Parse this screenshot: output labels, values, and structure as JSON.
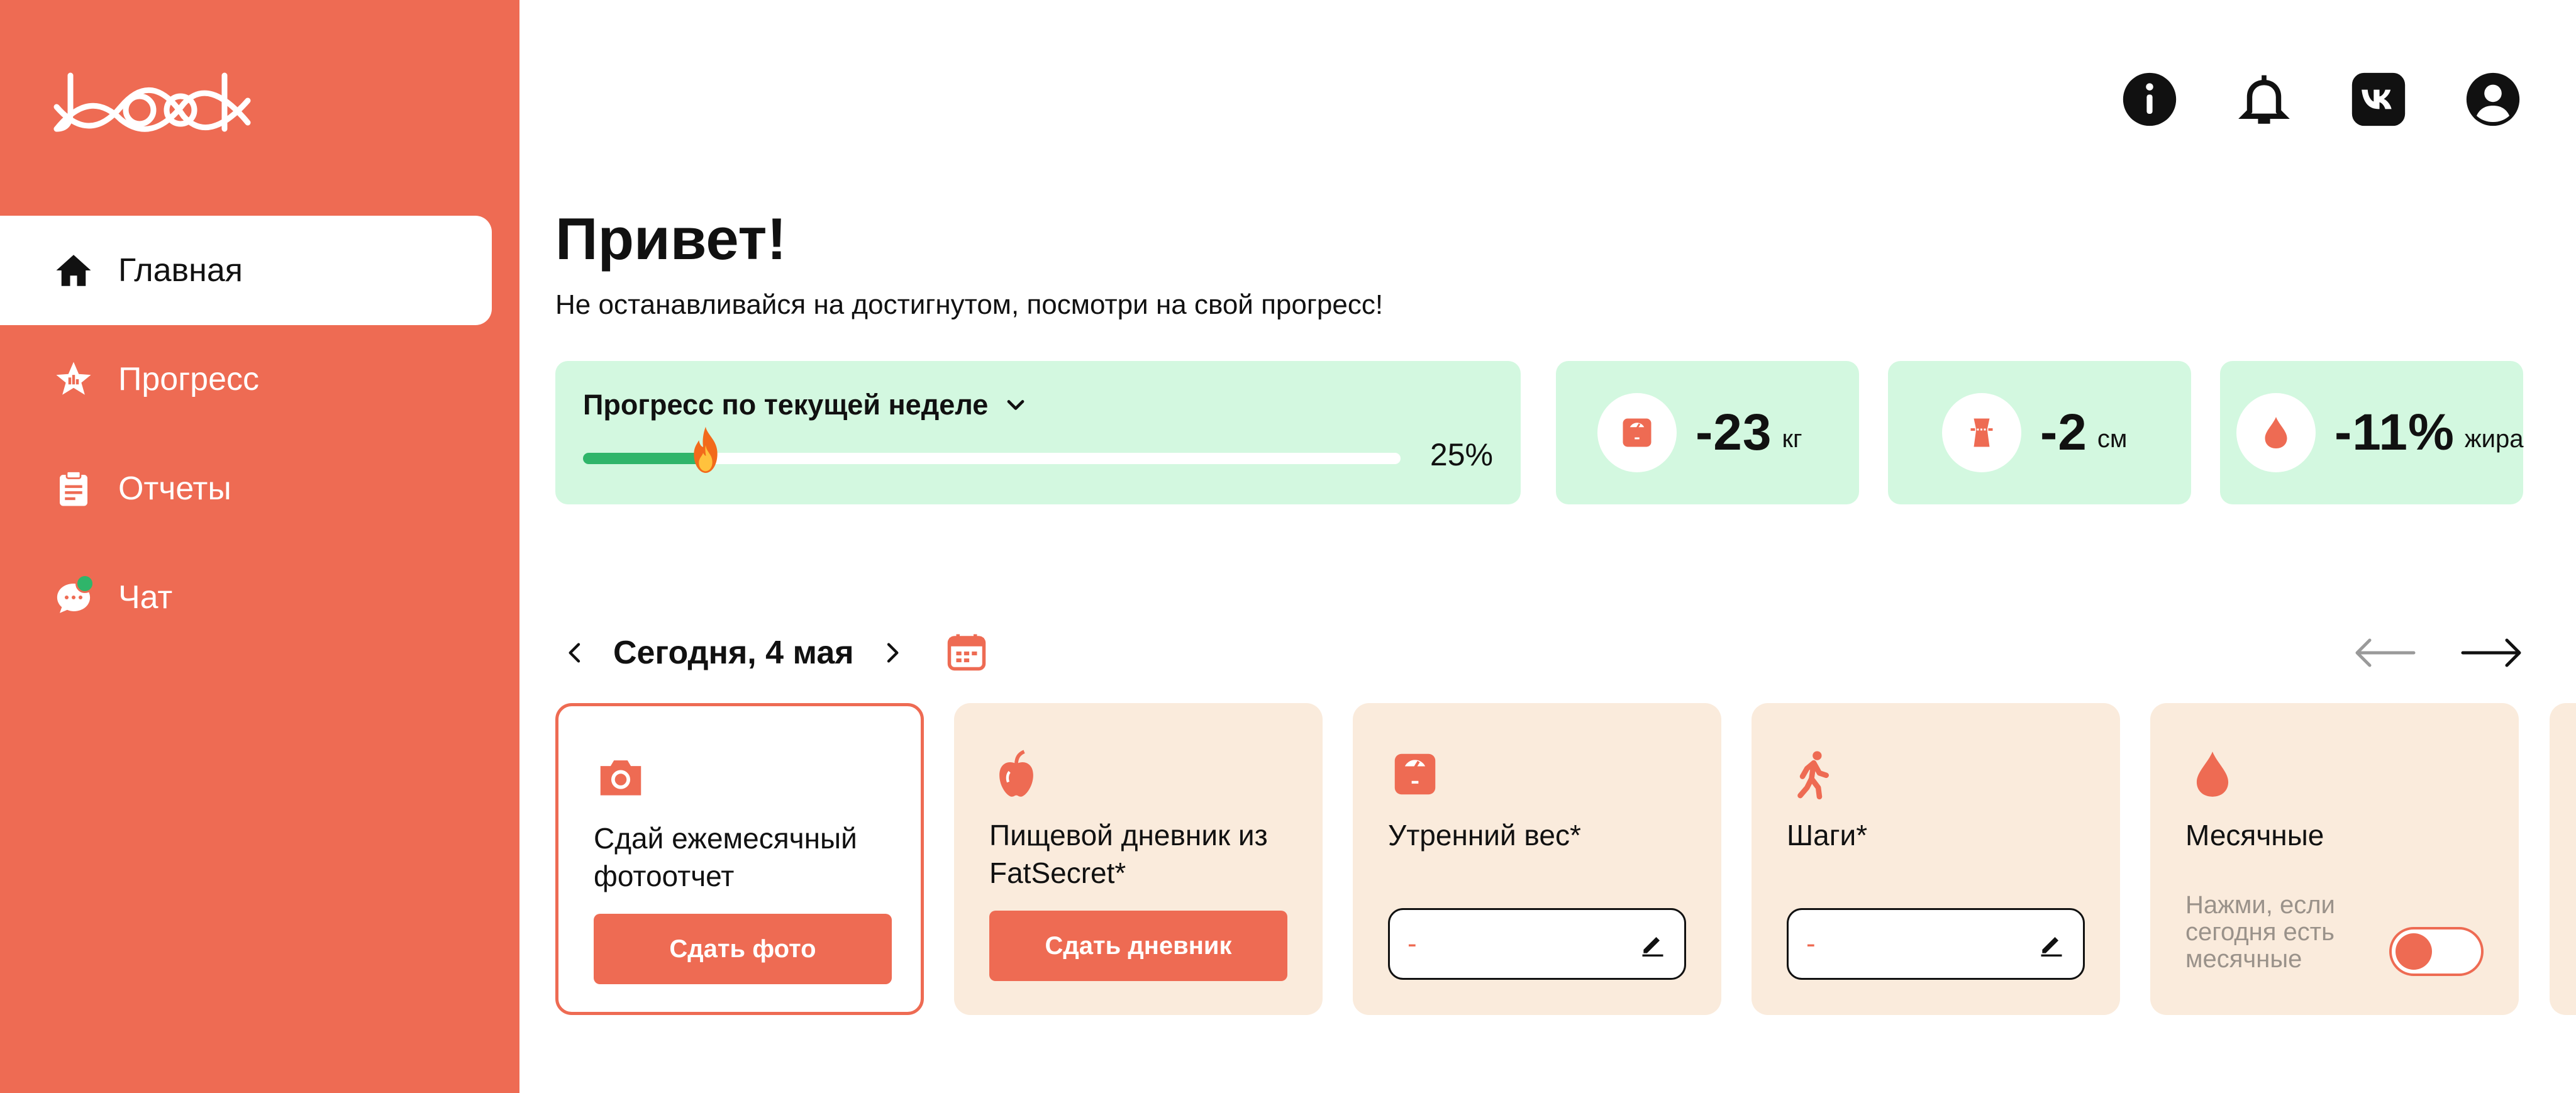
{
  "sidebar": {
    "logo_text": "Jbeak",
    "items": [
      {
        "label": "Главная",
        "icon": "home-icon",
        "active": true
      },
      {
        "label": "Прогресс",
        "icon": "star-icon",
        "active": false
      },
      {
        "label": "Отчеты",
        "icon": "clipboard-icon",
        "active": false
      },
      {
        "label": "Чат",
        "icon": "chat-icon",
        "active": false,
        "has_notification": true
      }
    ]
  },
  "header": {
    "icons": [
      "info-icon",
      "bell-icon",
      "vk-icon",
      "user-icon"
    ]
  },
  "greeting": {
    "title": "Привет!",
    "subtitle": "Не останавливайся на достигнутом, посмотри на свой прогресс!"
  },
  "week_progress": {
    "title": "Прогресс по текущей неделе",
    "percent_label": "25%",
    "fraction": 0.15
  },
  "stats": [
    {
      "value": "-23",
      "unit": "кг",
      "icon": "scale-icon"
    },
    {
      "value": "-2",
      "unit": "см",
      "icon": "waist-icon"
    },
    {
      "value": "-11%",
      "unit": "жира",
      "icon": "drop-icon"
    }
  ],
  "date_nav": {
    "label": "Сегодня, 4 мая"
  },
  "tasks": [
    {
      "title": "Сдай ежемесячный фотоотчет",
      "button": "Сдать фото",
      "icon": "camera-icon"
    },
    {
      "title": "Пищевой дневник из FatSecret*",
      "button": "Сдать дневник",
      "icon": "apple-icon"
    },
    {
      "title": "Утренний вес*",
      "value": "-",
      "icon": "scale-icon"
    },
    {
      "title": "Шаги*",
      "value": "-",
      "icon": "walking-icon"
    },
    {
      "title": "Месячные",
      "hint": "Нажми, если сегодня есть месячные",
      "toggle_on": false,
      "icon": "drop-icon"
    }
  ],
  "colors": {
    "brand": "#EE6B53",
    "mint": "#D3F8E0",
    "beige": "#FAEBDC",
    "green": "#2FB56A"
  }
}
